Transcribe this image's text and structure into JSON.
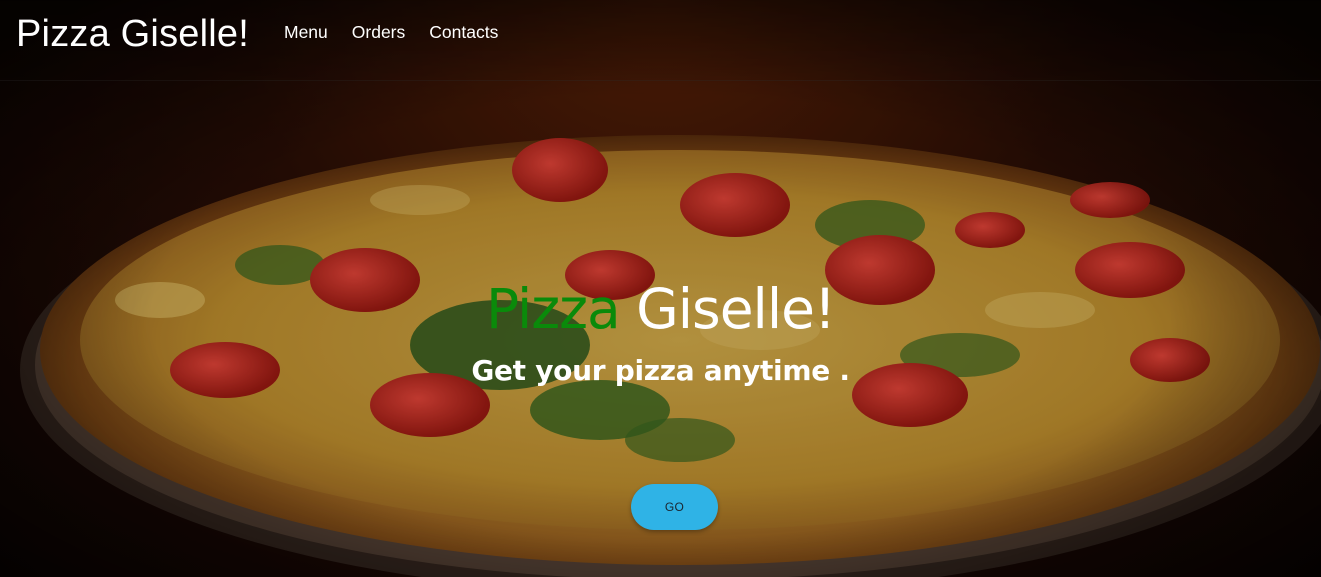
{
  "navbar": {
    "brand": "Pizza Giselle!",
    "links": [
      {
        "label": "Menu"
      },
      {
        "label": "Orders"
      },
      {
        "label": "Contacts"
      }
    ]
  },
  "hero": {
    "headline_accent": "Pizza",
    "headline_rest": " Giselle!",
    "tagline": "Get your pizza anytime .",
    "cta_label": "GO",
    "background_image": "pizza-photo",
    "colors": {
      "accent": "#0a8a0a",
      "button": "#2fb3e6",
      "text": "#ffffff"
    }
  }
}
